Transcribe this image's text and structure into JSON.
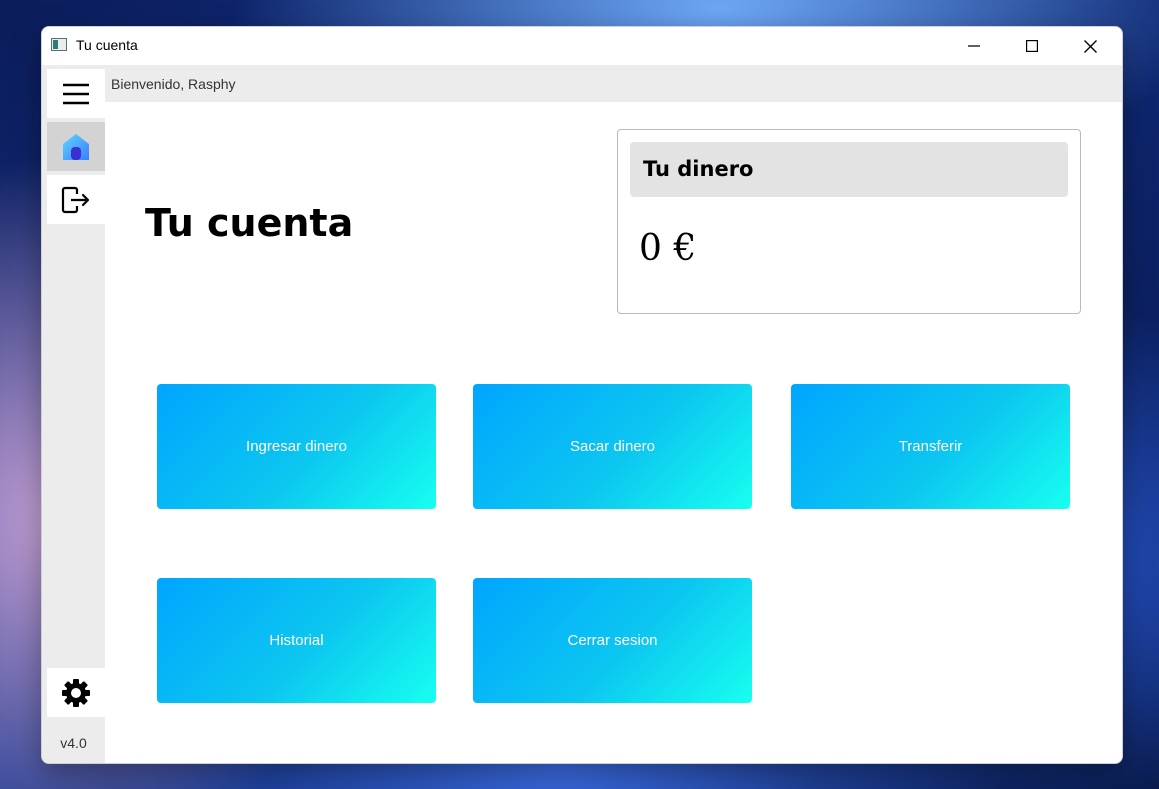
{
  "window": {
    "title": "Tu cuenta"
  },
  "header": {
    "welcome": "Bienvenido, Rasphy"
  },
  "sidebar": {
    "items": [
      {
        "icon": "menu-icon"
      },
      {
        "icon": "home-icon",
        "active": true
      },
      {
        "icon": "logout-icon"
      }
    ],
    "settings_icon": "gear-icon",
    "version": "v4.0"
  },
  "main": {
    "title": "Tu cuenta",
    "balance_card": {
      "title": "Tu dinero",
      "amount": "0 €"
    },
    "actions": [
      {
        "label": "Ingresar dinero"
      },
      {
        "label": "Sacar dinero"
      },
      {
        "label": "Transferir"
      },
      {
        "label": "Historial"
      },
      {
        "label": "Cerrar sesion"
      }
    ]
  },
  "colors": {
    "button_gradient_start": "#00a5ff",
    "button_gradient_end": "#17fff0",
    "sidebar_bg": "#ececec"
  }
}
